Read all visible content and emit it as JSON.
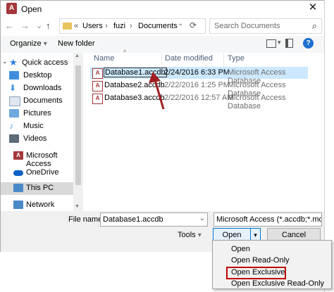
{
  "window": {
    "title": "Open",
    "app_icon": "A",
    "close_glyph": "✕"
  },
  "nav": {
    "back": "←",
    "forward": "→",
    "recent": "⌄",
    "up": "↑"
  },
  "address": {
    "separator": "«",
    "segments": [
      "Users",
      "fuzi",
      "Documents"
    ],
    "arrows": [
      "›",
      "›"
    ]
  },
  "search": {
    "placeholder": "Search Documents",
    "icon": "⌕"
  },
  "toolbar": {
    "organize": "Organize",
    "new_folder": "New folder",
    "help": "?"
  },
  "sidebar": {
    "items": [
      {
        "label": "Quick access",
        "icon": "star-icon",
        "color": "#2c7be0"
      },
      {
        "label": "Desktop",
        "icon": "desktop-icon",
        "color": "#3e8ee0"
      },
      {
        "label": "Downloads",
        "icon": "downloads-icon",
        "color": "#3e8ee0"
      },
      {
        "label": "Documents",
        "icon": "documents-icon",
        "color": "#8aa3bf"
      },
      {
        "label": "Pictures",
        "icon": "pictures-icon",
        "color": "#6fa8dc"
      },
      {
        "label": "Music",
        "icon": "music-icon",
        "color": "#4aa3df"
      },
      {
        "label": "Videos",
        "icon": "videos-icon",
        "color": "#5c6b7a"
      },
      {
        "label": "Microsoft Access",
        "icon": "access-icon",
        "color": "#a4373a"
      },
      {
        "label": "OneDrive",
        "icon": "onedrive-icon",
        "color": "#0f62c4"
      },
      {
        "label": "This PC",
        "icon": "pc-icon",
        "color": "#4a89c7"
      },
      {
        "label": "Network",
        "icon": "network-icon",
        "color": "#4a89c7"
      }
    ]
  },
  "columns": {
    "name": "Name",
    "date_modified": "Date modified",
    "type": "Type"
  },
  "files": [
    {
      "name": "Database1.accdb",
      "date": "2/24/2016 6:33 PM",
      "type": "Microsoft Access Database"
    },
    {
      "name": "Database2.accdb",
      "date": "2/22/2016 1:25 PM",
      "type": "Microsoft Access Database"
    },
    {
      "name": "Database3.accdb",
      "date": "2/22/2016 12:57 AM",
      "type": "Microsoft Access Database"
    }
  ],
  "bottom": {
    "file_name_label": "File name:",
    "file_name_value": "Database1.accdb",
    "file_type_value": "Microsoft Access (*.accdb;*.mc",
    "tools_label": "Tools",
    "open_label": "Open",
    "cancel_label": "Cancel"
  },
  "open_menu": {
    "items": [
      "Open",
      "Open Read-Only",
      "Open Exclusive",
      "Open Exclusive Read-Only"
    ],
    "highlighted": "Open Exclusive"
  },
  "colors": {
    "annotation_red": "#c00000",
    "selection": "#cce8ff",
    "access": "#a4373a"
  }
}
